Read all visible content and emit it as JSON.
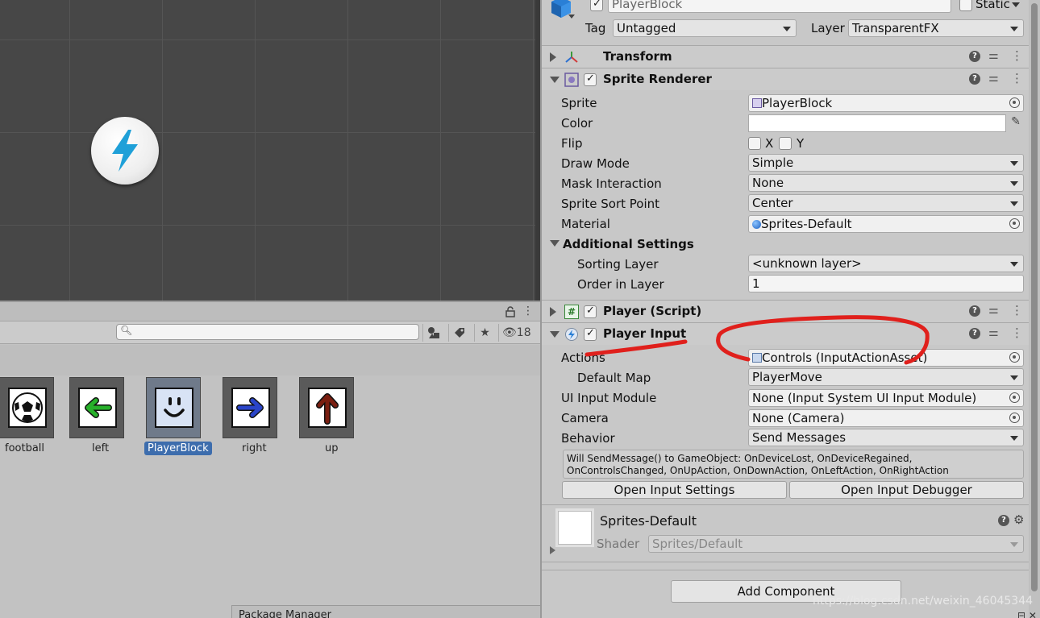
{
  "inspector": {
    "object_name": "PlayerBlock",
    "static_label": "Static",
    "tag_label": "Tag",
    "tag_value": "Untagged",
    "layer_label": "Layer",
    "layer_value": "TransparentFX"
  },
  "transform": {
    "title": "Transform"
  },
  "sprite_renderer": {
    "title": "Sprite Renderer",
    "sprite_label": "Sprite",
    "sprite_value": "PlayerBlock",
    "color_label": "Color",
    "flip_label": "Flip",
    "flip_x": "X",
    "flip_y": "Y",
    "draw_mode_label": "Draw Mode",
    "draw_mode_value": "Simple",
    "mask_label": "Mask Interaction",
    "mask_value": "None",
    "sort_point_label": "Sprite Sort Point",
    "sort_point_value": "Center",
    "material_label": "Material",
    "material_value": "Sprites-Default",
    "additional_label": "Additional Settings",
    "sorting_layer_label": "Sorting Layer",
    "sorting_layer_value": "<unknown layer>",
    "order_label": "Order in Layer",
    "order_value": "1"
  },
  "player_script": {
    "title": "Player (Script)"
  },
  "player_input": {
    "title": "Player Input",
    "actions_label": "Actions",
    "actions_value": "Controls (InputActionAsset)",
    "default_map_label": "Default Map",
    "default_map_value": "PlayerMove",
    "ui_module_label": "UI Input Module",
    "ui_module_value": "None (Input System UI Input Module)",
    "camera_label": "Camera",
    "camera_value": "None (Camera)",
    "behavior_label": "Behavior",
    "behavior_value": "Send Messages",
    "help_line1": "Will SendMessage() to GameObject: OnDeviceLost, OnDeviceRegained,",
    "help_line2": "OnControlsChanged, OnUpAction, OnDownAction, OnLeftAction, OnRightAction",
    "open_settings": "Open Input Settings",
    "open_debugger": "Open Input Debugger"
  },
  "material": {
    "name": "Sprites-Default",
    "shader_label": "Shader",
    "shader_value": "Sprites/Default"
  },
  "add_component": "Add Component",
  "project": {
    "hidden_count": "18",
    "assets": [
      {
        "label": "football"
      },
      {
        "label": "left"
      },
      {
        "label": "PlayerBlock"
      },
      {
        "label": "right"
      },
      {
        "label": "up"
      }
    ]
  },
  "package_manager_tab": "Package Manager",
  "watermark": "https://blog.csdn.net/weixin_46045344",
  "colors": {
    "selection": "#3d6dad",
    "annotation": "#e0201c",
    "lightning": "#1fa0d8"
  }
}
